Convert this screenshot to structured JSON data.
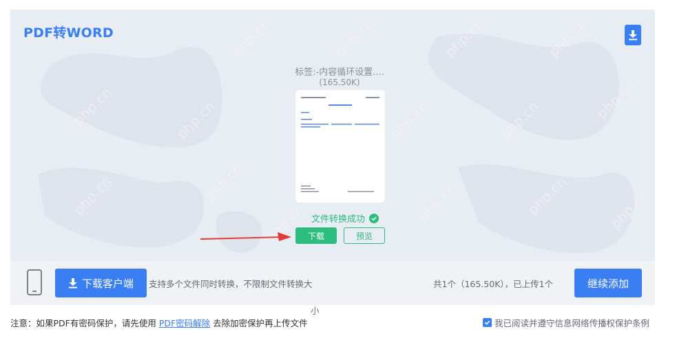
{
  "header": {
    "title": "PDF转WORD",
    "download_icon": "download-icon"
  },
  "file": {
    "name": "标签:-内容循环设置....",
    "size": "(165.50K)",
    "status": "文件转换成功",
    "download_label": "下载",
    "preview_label": "预览"
  },
  "bottom_bar": {
    "client_button_label": "下载客户端",
    "client_desc": "支持多个文件同时转换，不限制文件转换大",
    "client_desc_wrap": "小",
    "count_text": "共1个（165.50K），已上传1个",
    "continue_label": "继续添加"
  },
  "footer": {
    "notice_prefix": "注意：如果PDF有密码保护，请先使用 ",
    "notice_link": "PDF密码解除",
    "notice_suffix": " 去除加密保护再上传文件",
    "agreement_label": "我已阅读并遵守信息网络传播权保护条例",
    "agreement_checked": true
  },
  "colors": {
    "accent": "#3a7ef4",
    "success": "#2bbd7e",
    "arrow": "#e03a3a"
  }
}
